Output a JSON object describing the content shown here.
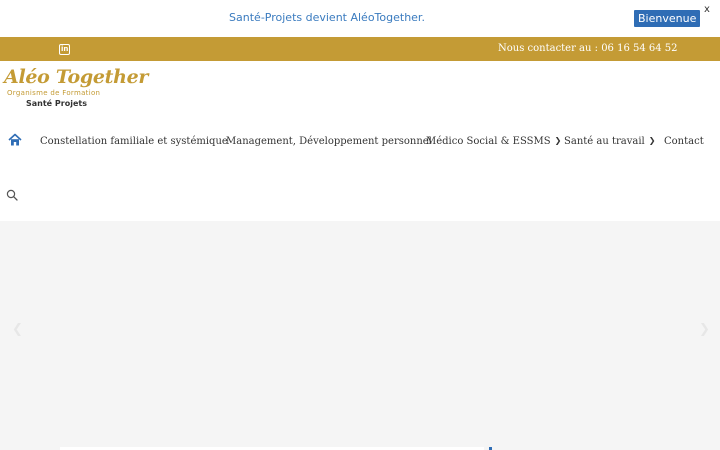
{
  "notice": {
    "text": "Santé-Projets devient AléoTogether.",
    "button_label": "Bienvenue",
    "close_label": "x"
  },
  "topbar": {
    "social_icon": "linkedin-icon",
    "contact_text": "Nous contacter au : 06 16 54 64 52"
  },
  "logo": {
    "title": "Aléo Together",
    "subtitle": "Organisme de Formation",
    "tagline": "Santé Projets"
  },
  "nav": {
    "home_icon": "home-icon",
    "items": [
      {
        "label": "Constellation familiale et systémique",
        "has_dropdown": false
      },
      {
        "label": "Management, Développement personnel",
        "has_dropdown": false
      },
      {
        "label": "Médico Social & ESSMS",
        "has_dropdown": true
      },
      {
        "label": "Santé au travail",
        "has_dropdown": true
      },
      {
        "label": "Contact",
        "has_dropdown": false
      }
    ],
    "search_icon": "search-icon"
  },
  "slider": {
    "prev_icon": "chevron-left-icon",
    "next_icon": "chevron-right-icon"
  },
  "colors": {
    "brand_gold": "#c49b35",
    "link_blue": "#3a7bbf",
    "button_blue": "#2f6db5",
    "hero_bg": "#f5f5f5"
  }
}
